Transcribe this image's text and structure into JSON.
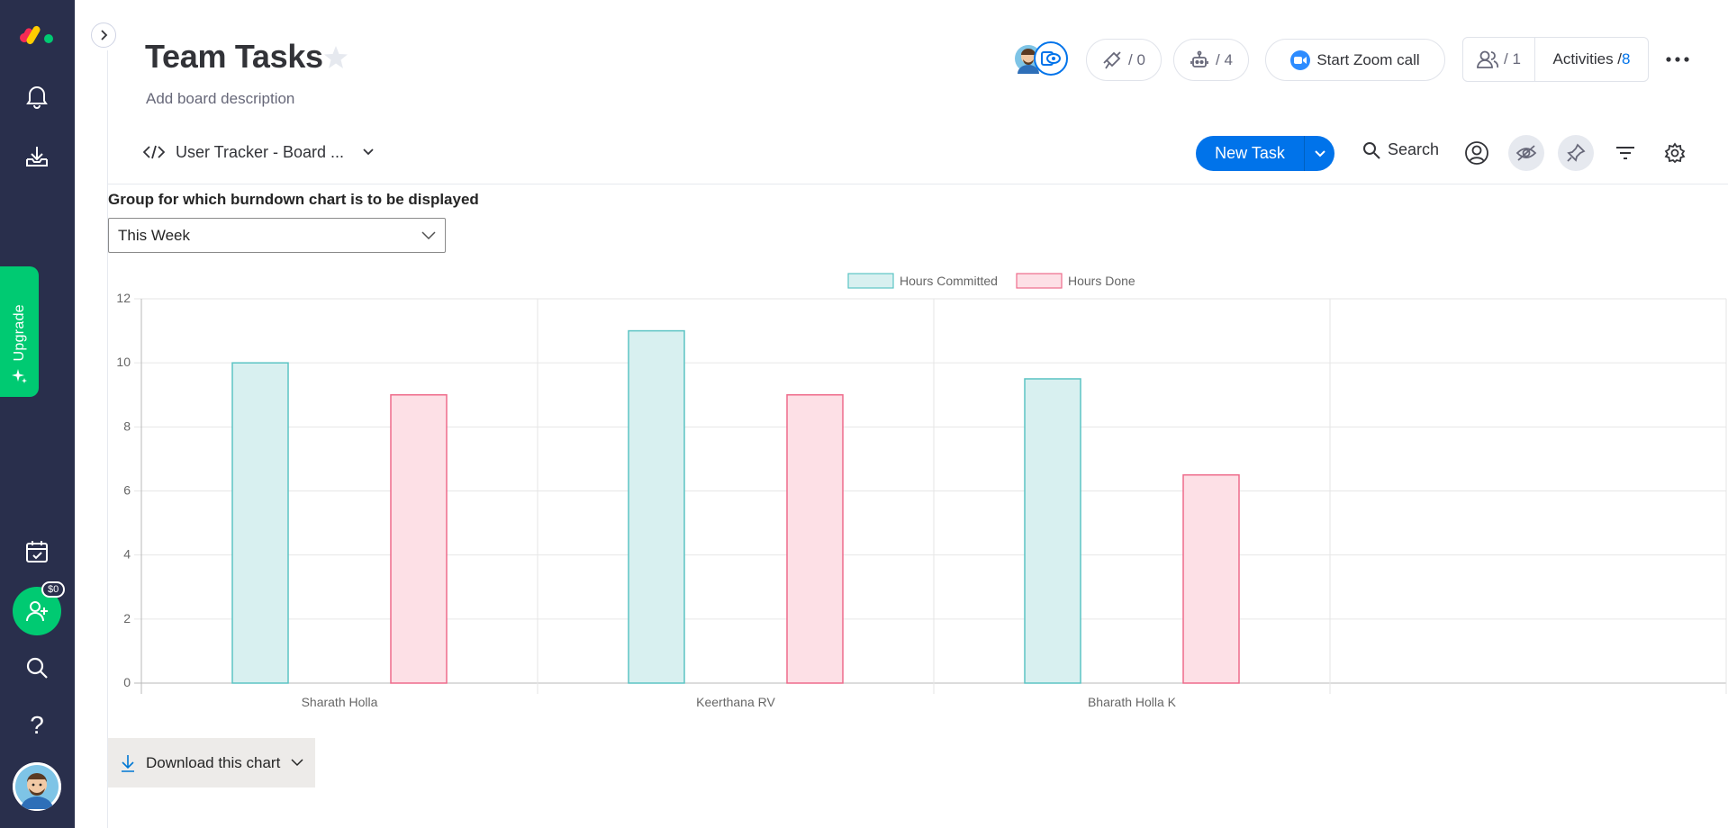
{
  "board": {
    "title": "Team Tasks",
    "description": "Add board description"
  },
  "header": {
    "integrations_count": "/ 0",
    "automations_count": "/ 4",
    "zoom_label": "Start Zoom call",
    "members_count": "/ 1",
    "activities_label": "Activities /",
    "activities_count": "8"
  },
  "toolbar": {
    "view_name": "User Tracker - Board ...",
    "new_task_label": "New Task",
    "search_label": "Search"
  },
  "rail": {
    "upgrade_label": "Upgrade",
    "invite_badge": "$0",
    "help_label": "?"
  },
  "widget": {
    "group_label": "Group for which burndown chart is to be displayed",
    "group_selected": "This Week",
    "download_label": "Download this chart"
  },
  "colors": {
    "committed_fill": "#d8f0f0",
    "committed_stroke": "#5cc4c4",
    "done_fill": "#fde0e6",
    "done_stroke": "#ee6b8b",
    "brand_blue": "#0073ea",
    "rail_bg": "#292f4c",
    "upgrade_green": "#00ca72"
  },
  "chart_data": {
    "type": "bar",
    "categories": [
      "Sharath Holla",
      "Keerthana RV",
      "Bharath Holla K",
      ""
    ],
    "series": [
      {
        "name": "Hours Committed",
        "values": [
          10,
          11,
          9.5,
          null
        ]
      },
      {
        "name": "Hours Done",
        "values": [
          9,
          9,
          6.5,
          null
        ]
      }
    ],
    "ylim": [
      0,
      12
    ],
    "yticks": [
      0,
      2,
      4,
      6,
      8,
      10,
      12
    ],
    "legend": "top-center",
    "grid": true
  }
}
